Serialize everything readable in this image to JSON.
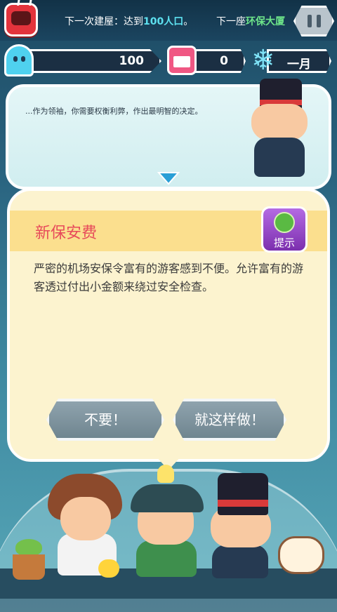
{
  "top_bar": {
    "next_building_prefix": "下一次建屋：达到",
    "next_building_highlight": "100人口",
    "next_building_suffix": "。",
    "next_tower_prefix": "下一座",
    "next_tower_highlight": "环保大厦"
  },
  "stats": {
    "population": "100",
    "calendar_count": "0",
    "month": "一月"
  },
  "advisor": {
    "message": "...作为领袖，你需要权衡利弊，作出最明智的决定。"
  },
  "event_card": {
    "title": "新保安费",
    "hint_label": "提示",
    "description": "严密的机场安保令富有的游客感到不便。允许富有的游客透过付出小金额来绕过安全检查。",
    "reject_label": "不要！",
    "accept_label": "就这样做！"
  },
  "colors": {
    "title_red": "#e74a5a",
    "highlight_cyan": "#5de0ef",
    "highlight_green": "#6ee58a",
    "hint_purple": "#8d3bbf"
  },
  "icons": {
    "tv": "tv-icon",
    "pause": "pause-icon",
    "population": "ghost-icon",
    "calendar": "calendar-icon",
    "season": "snowflake-icon",
    "hint": "leaf-ball-icon"
  }
}
